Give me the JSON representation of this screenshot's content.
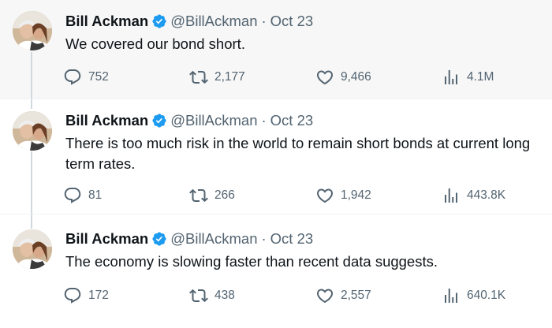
{
  "colors": {
    "text": "#0f1419",
    "secondary": "#536471",
    "verified": "#1d9bf0",
    "highlight_bg": "#f7f7f7"
  },
  "tweets": [
    {
      "author": {
        "name": "Bill Ackman",
        "handle": "@BillAckman"
      },
      "separator": "·",
      "date": "Oct 23",
      "text": "We covered our bond short.",
      "stats": {
        "replies": "752",
        "retweets": "2,177",
        "likes": "9,466",
        "views": "4.1M"
      }
    },
    {
      "author": {
        "name": "Bill Ackman",
        "handle": "@BillAckman"
      },
      "separator": "·",
      "date": "Oct 23",
      "text": "There is too much risk in the world to remain short bonds at current long\nterm rates.",
      "stats": {
        "replies": "81",
        "retweets": "266",
        "likes": "1,942",
        "views": "443.8K"
      }
    },
    {
      "author": {
        "name": "Bill Ackman",
        "handle": "@BillAckman"
      },
      "separator": "·",
      "date": "Oct 23",
      "text": "The economy is slowing faster than recent data suggests.",
      "stats": {
        "replies": "172",
        "retweets": "438",
        "likes": "2,557",
        "views": "640.1K"
      }
    }
  ],
  "icons": {
    "reply": "reply-icon",
    "retweet": "retweet-icon",
    "like": "heart-icon",
    "views": "views-icon",
    "verified": "verified-badge-icon"
  }
}
